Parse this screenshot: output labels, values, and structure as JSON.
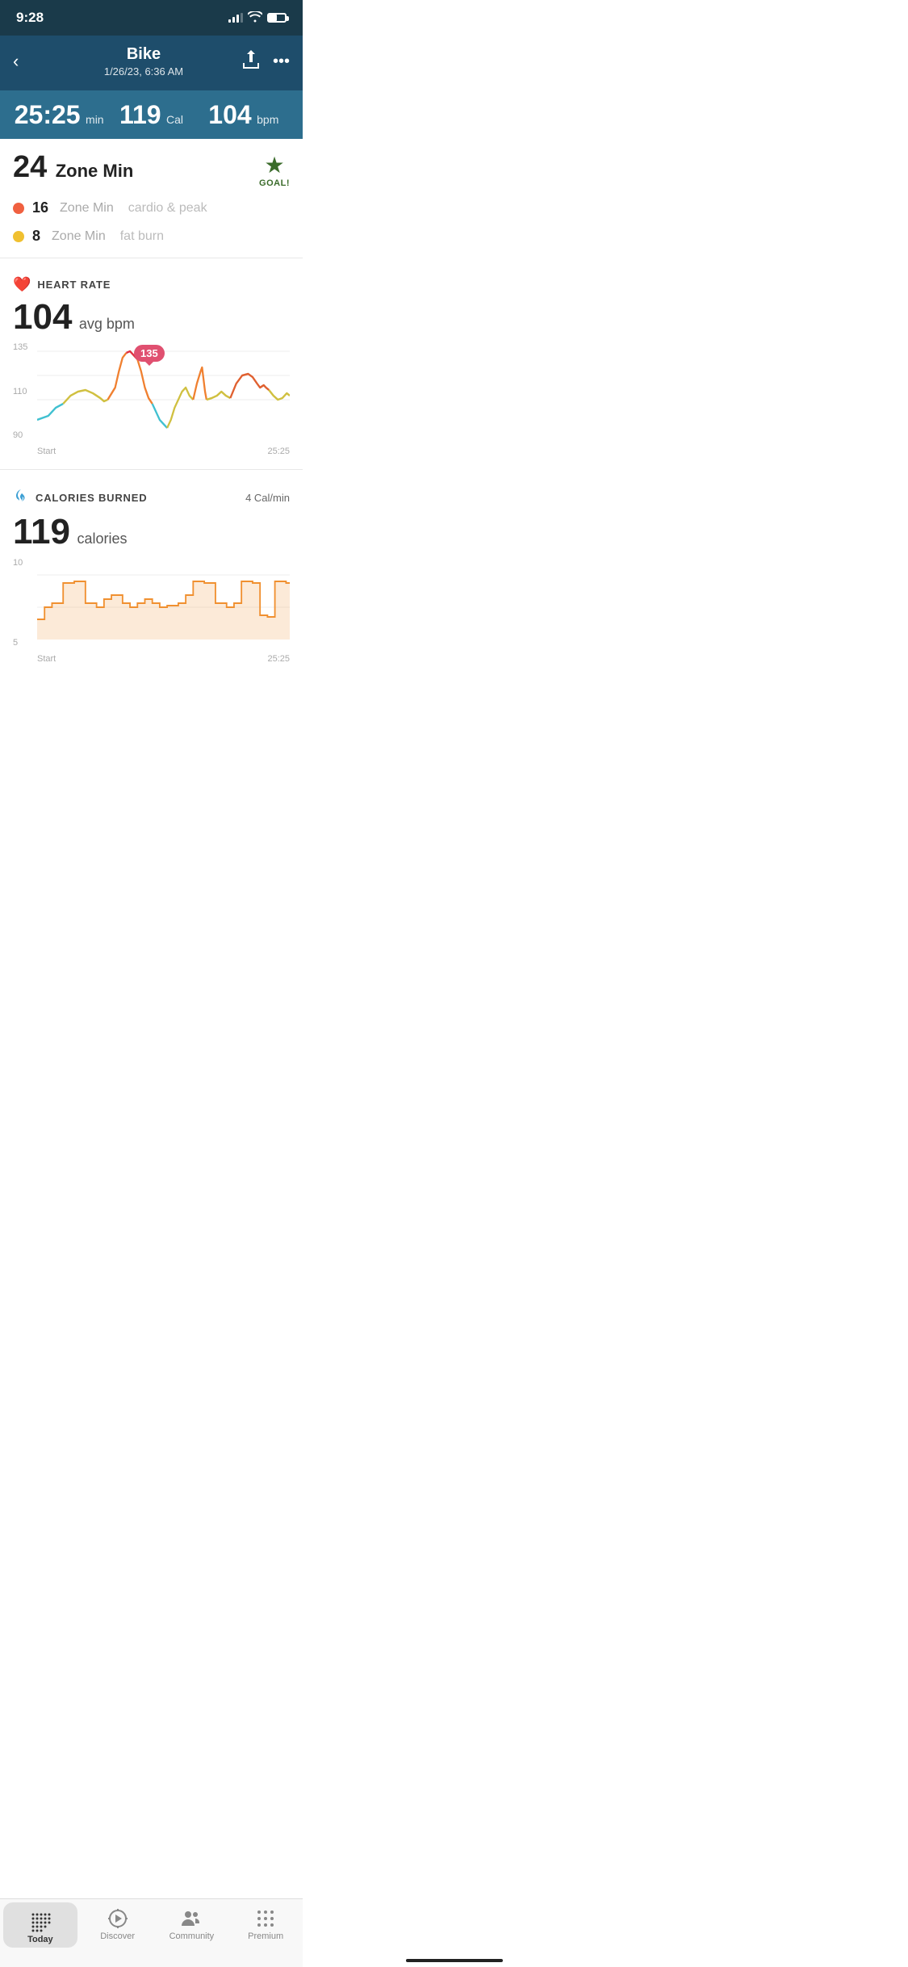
{
  "statusBar": {
    "time": "9:28"
  },
  "header": {
    "backLabel": "‹",
    "title": "Bike",
    "subtitle": "1/26/23, 6:36 AM",
    "shareLabel": "⬆",
    "moreLabel": "•••"
  },
  "stats": [
    {
      "value": "25:25",
      "unit": "min"
    },
    {
      "value": "119",
      "unit": "Cal"
    },
    {
      "value": "104",
      "unit": "bpm"
    }
  ],
  "zoneMins": {
    "value": "24",
    "label": "Zone Min",
    "goalLabel": "GOAL!",
    "details": [
      {
        "color": "#f06040",
        "value": "16",
        "label": "Zone Min",
        "sublabel": "cardio & peak"
      },
      {
        "color": "#f0c030",
        "value": "8",
        "label": "Zone Min",
        "sublabel": "fat burn"
      }
    ]
  },
  "heartRate": {
    "sectionTitle": "HEART RATE",
    "value": "104",
    "unit": "avg bpm",
    "tooltipValue": "135",
    "yLabels": [
      "135",
      "110",
      "90"
    ],
    "xLabels": [
      "Start",
      "25:25"
    ]
  },
  "caloriesBurned": {
    "sectionTitle": "CALORIES BURNED",
    "rateLabel": "4 Cal/min",
    "value": "119",
    "unit": "calories",
    "yLabels": [
      "10",
      "5"
    ],
    "xLabels": [
      "Start",
      "25:25"
    ]
  },
  "bottomNav": [
    {
      "id": "today",
      "label": "Today",
      "active": true
    },
    {
      "id": "discover",
      "label": "Discover",
      "active": false
    },
    {
      "id": "community",
      "label": "Community",
      "active": false
    },
    {
      "id": "premium",
      "label": "Premium",
      "active": false
    }
  ]
}
